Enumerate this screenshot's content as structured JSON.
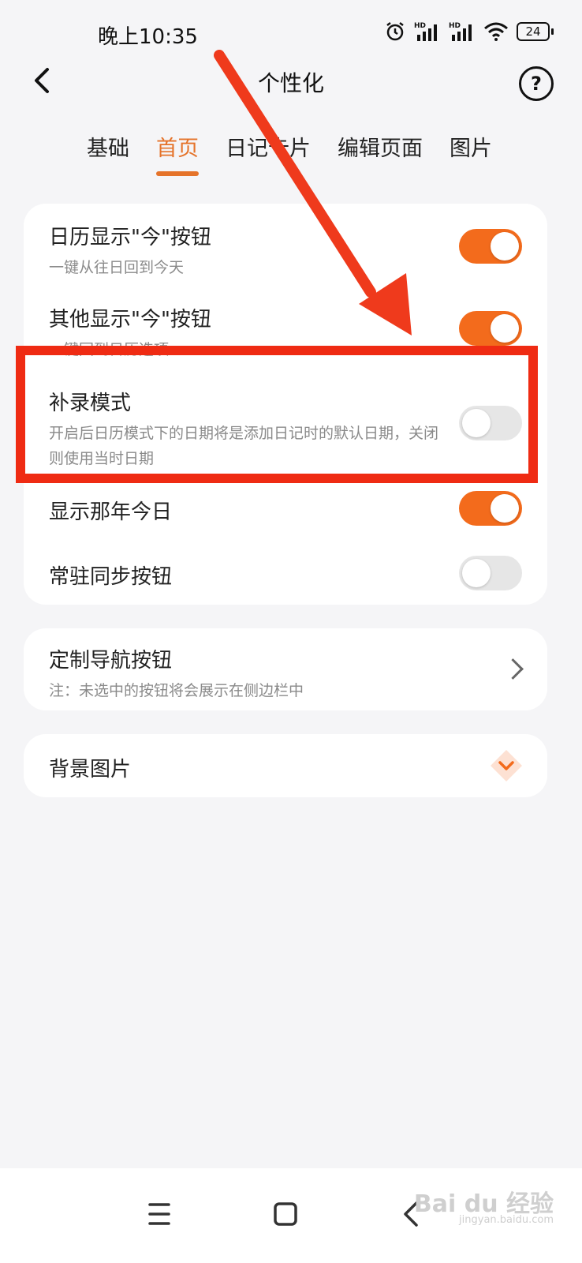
{
  "status_bar": {
    "time": "晚上10:35",
    "battery": "24",
    "icons": [
      "alarm-icon",
      "hd-signal-icon",
      "hd-signal-icon",
      "wifi-icon",
      "battery-icon"
    ]
  },
  "header": {
    "title": "个性化",
    "back_icon": "chevron-left-icon",
    "help_label": "?"
  },
  "tabs": [
    {
      "label": "基础",
      "active": false
    },
    {
      "label": "首页",
      "active": true
    },
    {
      "label": "日记卡片",
      "active": false
    },
    {
      "label": "编辑页面",
      "active": false
    },
    {
      "label": "图片",
      "active": false
    }
  ],
  "settings": [
    {
      "title": "日历显示\"今\"按钮",
      "desc": "一键从往日回到今天",
      "enabled": true
    },
    {
      "title": "其他显示\"今\"按钮",
      "desc": "一键回到日历选项",
      "enabled": true
    },
    {
      "title": "补录模式",
      "desc": "开启后日历模式下的日期将是添加日记时的默认日期，关闭则使用当时日期",
      "enabled": false
    },
    {
      "title": "显示那年今日",
      "desc": "",
      "enabled": true
    },
    {
      "title": "常驻同步按钮",
      "desc": "",
      "enabled": false
    }
  ],
  "nav_custom": {
    "title": "定制导航按钮",
    "desc": "注：未选中的按钮将会展示在侧边栏中"
  },
  "background": {
    "title": "背景图片",
    "icon": "vip-diamond-icon"
  },
  "bottom_nav": [
    "menu-icon",
    "home-icon",
    "back-icon"
  ],
  "watermark": {
    "text": "Bai du 经验",
    "sub": "jingyan.baidu.com"
  },
  "colors": {
    "accent": "#e5732a",
    "toggle_on": "#f36b1c",
    "annotation": "#ef2b13"
  }
}
